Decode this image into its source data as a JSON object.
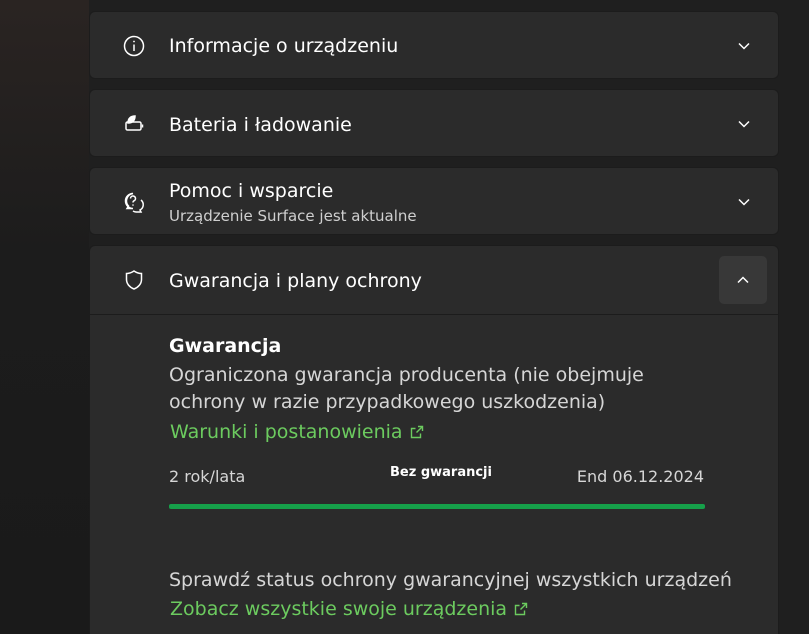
{
  "cards": {
    "device_info": {
      "title": "Informacje o urządzeniu",
      "icon": "info-icon"
    },
    "battery": {
      "title": "Bateria i ładowanie",
      "icon": "battery-leaf-icon"
    },
    "help": {
      "title": "Pomoc i wsparcie",
      "subtitle": "Urządzenie Surface jest aktualne",
      "icon": "help-chat-icon"
    },
    "warranty": {
      "title": "Gwarancja i plany ochrony",
      "icon": "shield-icon",
      "expanded": true
    }
  },
  "warranty": {
    "heading": "Gwarancja",
    "description": "Ograniczona gwarancja producenta (nie obejmuje ochrony w razie przypadkowego uszkodzenia)",
    "terms_link": "Warunki i postanowienia",
    "duration": "2 rok/lata",
    "status": "Bez gwarancji",
    "end_date": "End 06.12.2024",
    "progress_percent": 100,
    "progress_color": "#16a04a"
  },
  "coverage": {
    "text": "Sprawdź status ochrony gwarancyjnej wszystkich urządzeń",
    "link": "Zobacz wszystkie swoje urządzenia"
  },
  "colors": {
    "card_bg": "#2b2b2b",
    "link": "#6ccb5f"
  }
}
